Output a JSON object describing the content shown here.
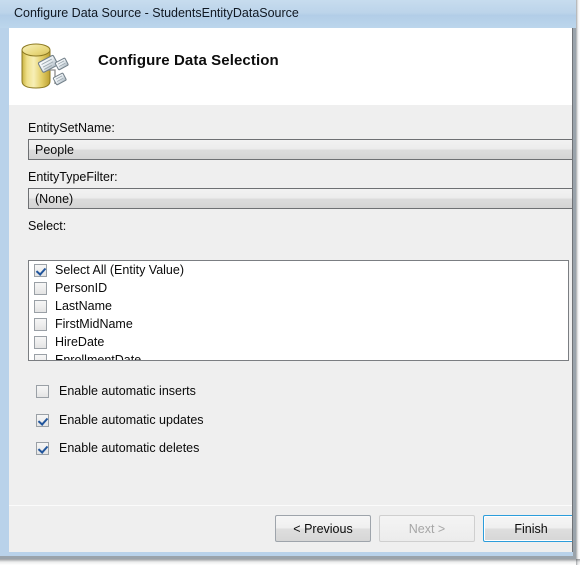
{
  "window": {
    "title": "Configure Data Source - StudentsEntityDataSource",
    "accent_color": "#b9d2ea",
    "titlebar_color": "#bcd4ea"
  },
  "header": {
    "title": "Configure Data Selection",
    "icon": "database-entity-icon"
  },
  "fields": {
    "entity_set_name": {
      "label": "EntitySetName:",
      "value": "People"
    },
    "entity_type_filter": {
      "label": "EntityTypeFilter:",
      "value": "(None)"
    },
    "select": {
      "label": "Select:"
    }
  },
  "select_list": {
    "items": [
      {
        "label": "Select All (Entity Value)",
        "checked": true
      },
      {
        "label": "PersonID",
        "checked": false
      },
      {
        "label": "LastName",
        "checked": false
      },
      {
        "label": "FirstMidName",
        "checked": false
      },
      {
        "label": "HireDate",
        "checked": false
      },
      {
        "label": "EnrollmentDate",
        "checked": false
      }
    ]
  },
  "options": [
    {
      "label": "Enable automatic inserts",
      "checked": false
    },
    {
      "label": "Enable automatic updates",
      "checked": true
    },
    {
      "label": "Enable automatic deletes",
      "checked": true
    }
  ],
  "footer": {
    "previous_label": "< Previous",
    "next_label": "Next >",
    "finish_label": "Finish",
    "previous_enabled": true,
    "next_enabled": false,
    "finish_default": true
  }
}
